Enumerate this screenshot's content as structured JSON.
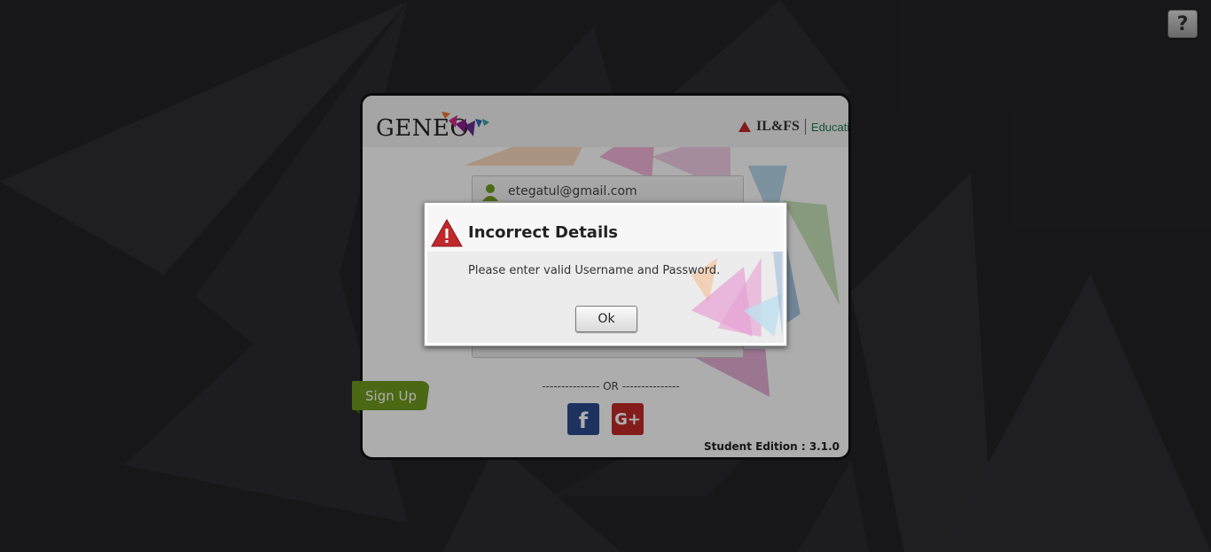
{
  "app": {
    "logo_text": "GENEO",
    "partner_brand": "IL&FS",
    "partner_division": "Education",
    "edition": "Student Edition : 3.1.0"
  },
  "help": {
    "icon": "help-cursor-icon",
    "label": "?"
  },
  "login": {
    "username_value": "etegatul@gmail.com",
    "username_icon": "user-icon",
    "or_text": "--------------- OR ---------------",
    "facebook_label": "f",
    "google_label": "G+",
    "signup_label": "Sign Up"
  },
  "dialog": {
    "icon": "warning-icon",
    "title": "Incorrect Details",
    "message": "Please enter valid Username and Password.",
    "ok_label": "Ok"
  },
  "colors": {
    "background": "#232327",
    "signup_green": "#6f9a1e",
    "facebook_blue": "#2c4a8c",
    "google_red": "#c22a28",
    "warning_red": "#c0282c",
    "education_green": "#1f7a52"
  }
}
